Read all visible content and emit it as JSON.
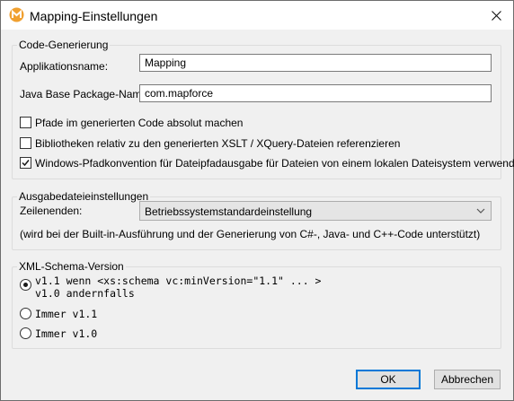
{
  "window": {
    "title": "Mapping-Einstellungen"
  },
  "code_generation": {
    "group_label": "Code-Generierung",
    "app_name_label": "Applikationsname:",
    "app_name_value": "Mapping",
    "package_label": "Java Base Package-Name:",
    "package_value": "com.mapforce",
    "checkboxes": [
      {
        "label": "Pfade im generierten Code absolut machen",
        "checked": false
      },
      {
        "label": "Bibliotheken relativ zu den generierten XSLT / XQuery-Dateien referenzieren",
        "checked": false
      },
      {
        "label": "Windows-Pfadkonvention für Dateipfadausgabe für Dateien von einem lokalen Dateisystem verwenden",
        "checked": true
      }
    ]
  },
  "output_settings": {
    "group_label": "Ausgabedateieinstellungen",
    "line_endings_label": "Zeilenenden:",
    "line_endings_value": "Betriebssystemstandardeinstellung",
    "note": "(wird bei der Built-in-Ausführung und der Generierung von C#-, Java- und C++-Code unterstützt)"
  },
  "xml_schema": {
    "group_label": "XML-Schema-Version",
    "options": [
      {
        "line1": "v1.1 wenn <xs:schema vc:minVersion=\"1.1\" ... >",
        "line2": "v1.0 andernfalls",
        "selected": true
      },
      {
        "line1": "Immer v1.1",
        "selected": false
      },
      {
        "line1": "Immer v1.0",
        "selected": false
      }
    ]
  },
  "buttons": {
    "ok": "OK",
    "cancel": "Abbrechen"
  },
  "icons": {
    "app": "mapforce-logo-icon",
    "close": "close-icon",
    "dropdown": "chevron-down-icon",
    "accent": "#f0a030"
  }
}
